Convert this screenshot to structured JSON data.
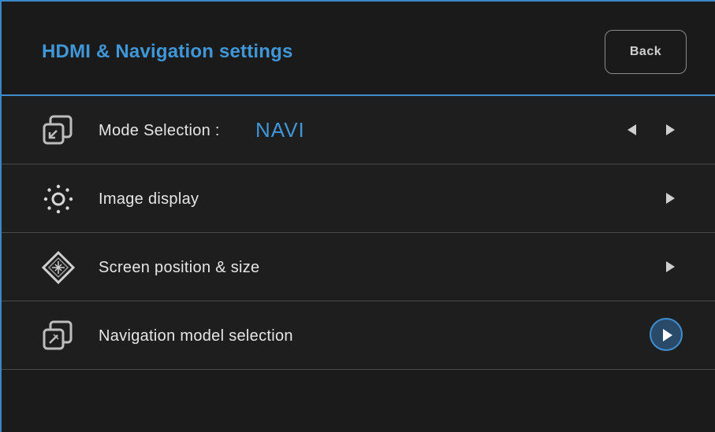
{
  "header": {
    "title": "HDMI & Navigation settings",
    "back_label": "Back"
  },
  "rows": [
    {
      "label": "Mode Selection :",
      "value": "NAVI",
      "icon": "mode-selection-icon",
      "controls": [
        "left-arrow",
        "right-arrow"
      ]
    },
    {
      "label": "Image display",
      "icon": "sun-icon",
      "controls": [
        "right-arrow"
      ]
    },
    {
      "label": "Screen position & size",
      "icon": "move-diamond-icon",
      "controls": [
        "right-arrow"
      ]
    },
    {
      "label": "Navigation model selection",
      "icon": "compass-window-icon",
      "controls": [
        "circle-right-arrow"
      ]
    }
  ],
  "colors": {
    "accent": "#3f97d8",
    "background": "#1b1b1b",
    "text": "#e6e6e6"
  }
}
